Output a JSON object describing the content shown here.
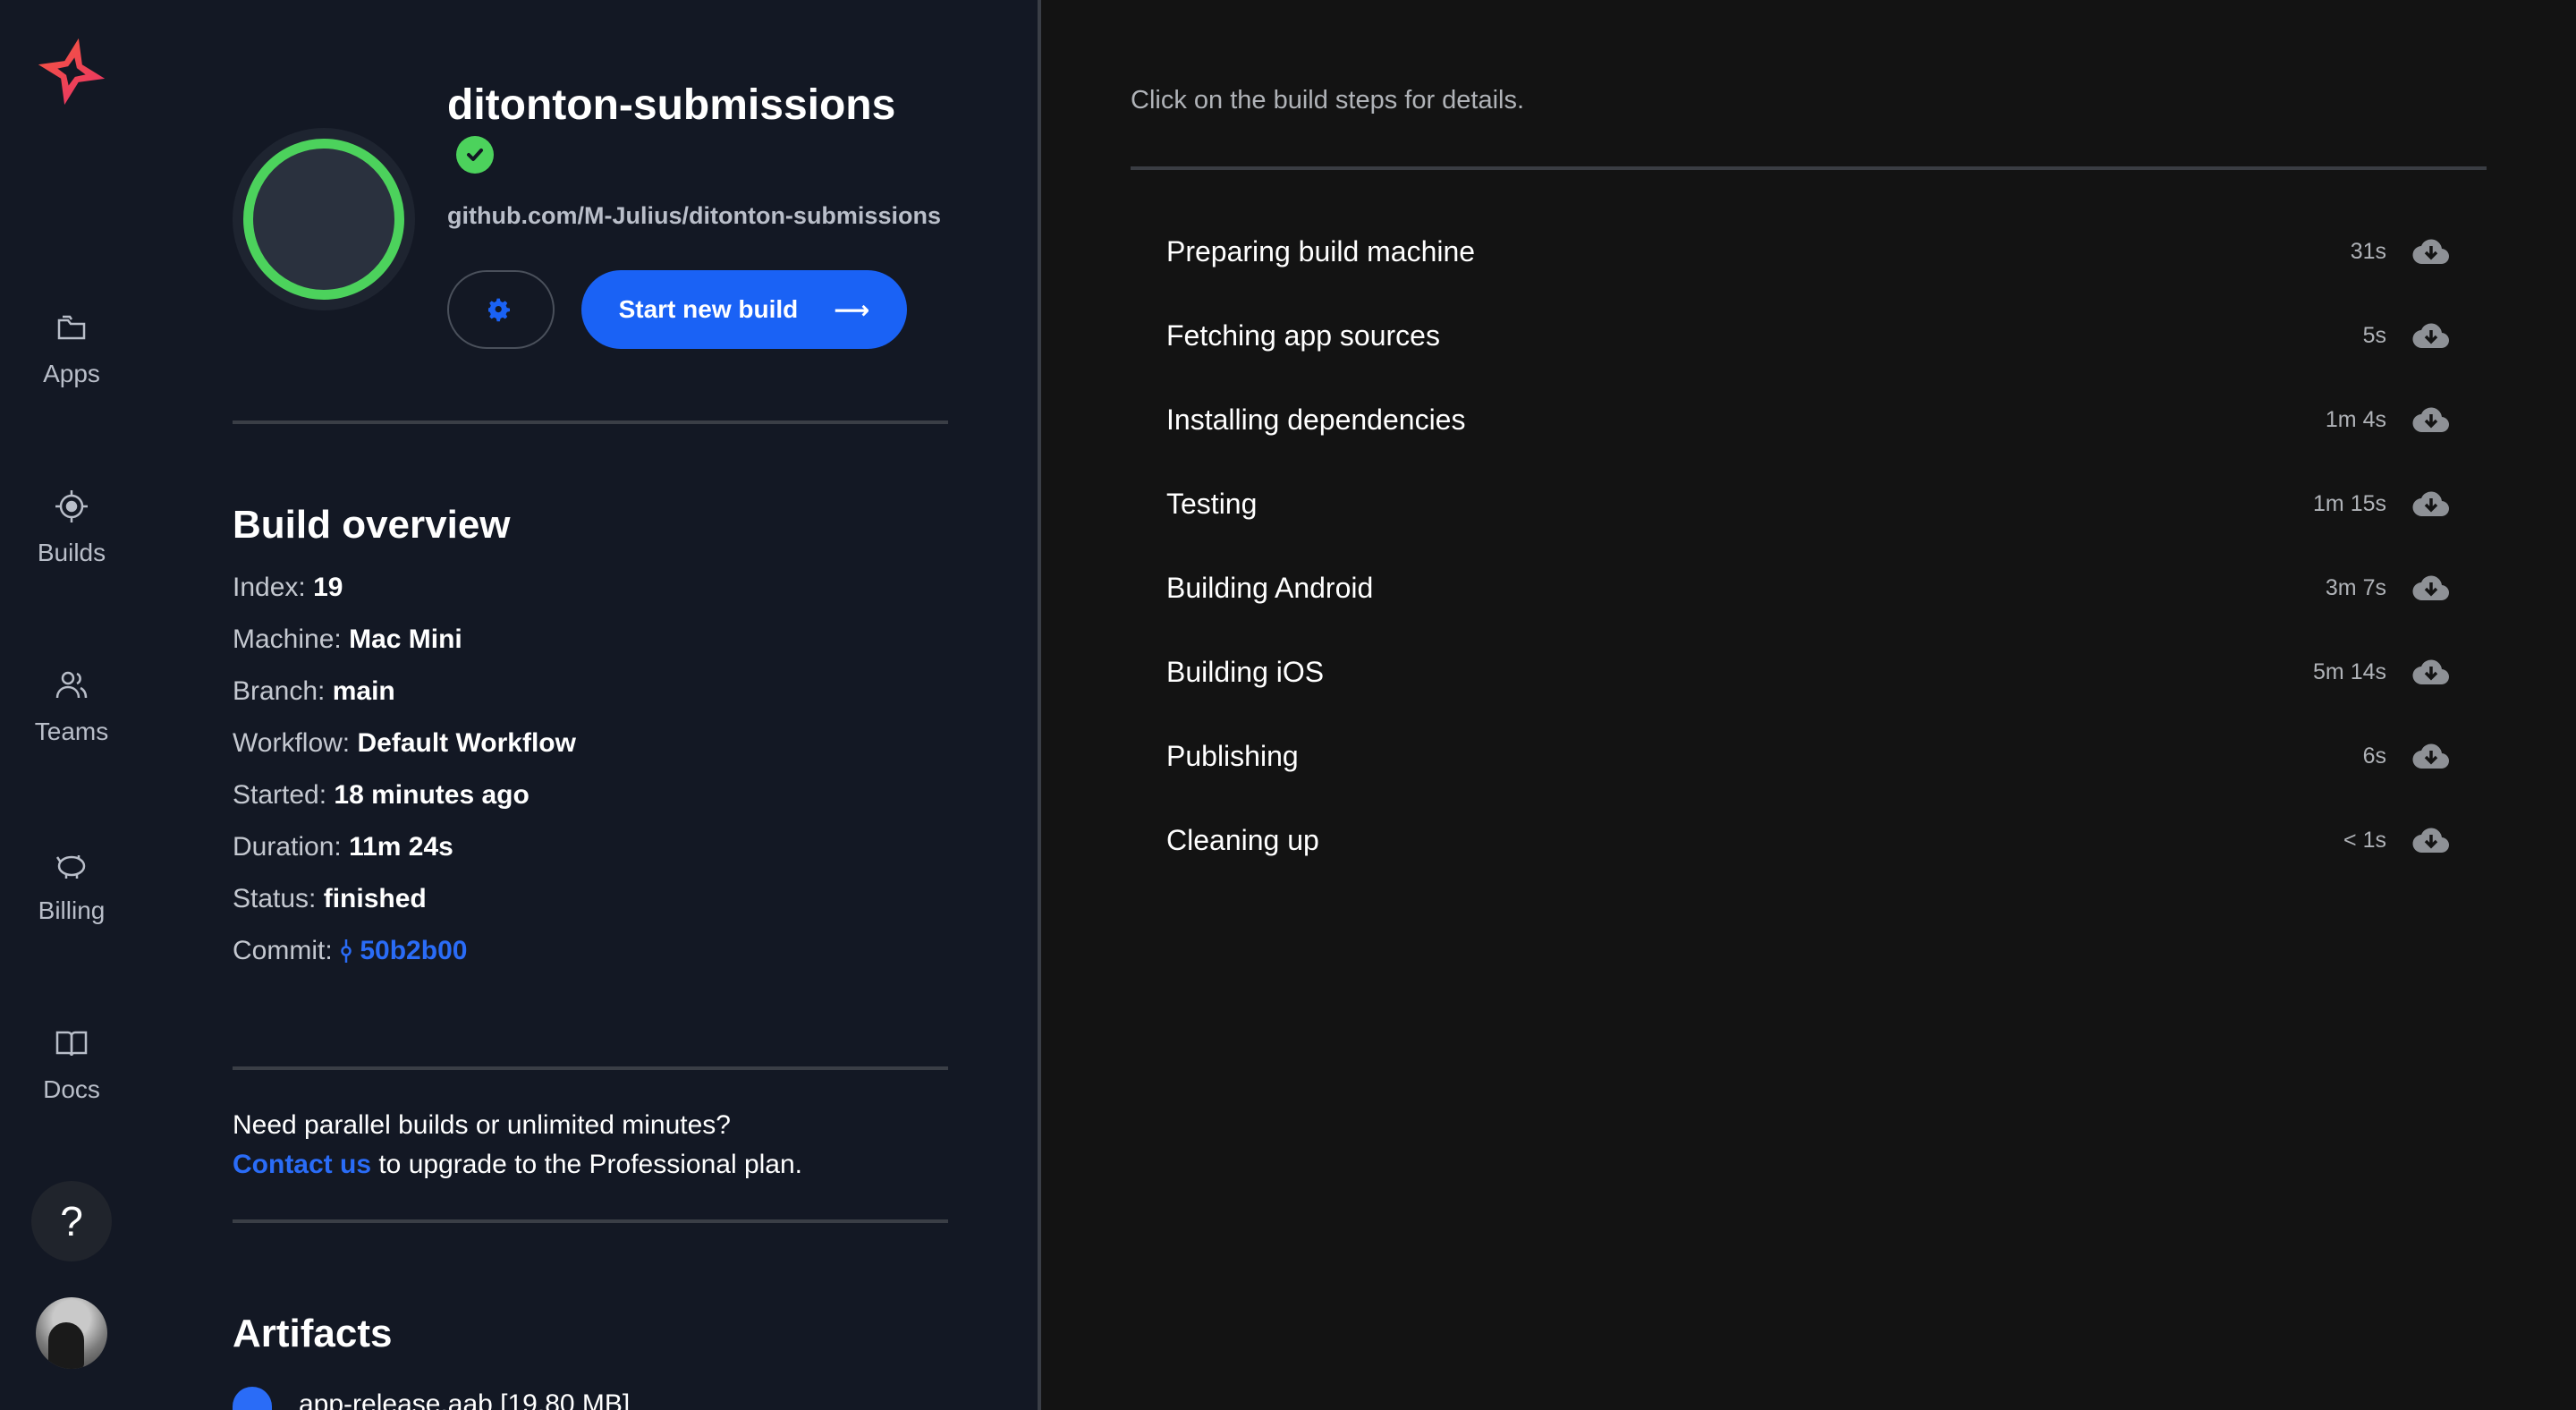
{
  "nav": {
    "items": [
      {
        "label": "Apps",
        "icon": "apps-icon"
      },
      {
        "label": "Builds",
        "icon": "builds-icon"
      },
      {
        "label": "Teams",
        "icon": "teams-icon"
      },
      {
        "label": "Billing",
        "icon": "billing-icon"
      },
      {
        "label": "Docs",
        "icon": "docs-icon"
      }
    ],
    "help": "?"
  },
  "app": {
    "name": "ditonton-submissions",
    "repo": "github.com/M-Julius/ditonton-submissions",
    "start_build_label": "Start new build",
    "arrow": "⟶"
  },
  "overview": {
    "title": "Build overview",
    "rows": [
      {
        "label": "Index:",
        "value": "19"
      },
      {
        "label": "Machine:",
        "value": "Mac Mini"
      },
      {
        "label": "Branch:",
        "value": "main"
      },
      {
        "label": "Workflow:",
        "value": "Default Workflow"
      },
      {
        "label": "Started:",
        "value": "18 minutes ago"
      },
      {
        "label": "Duration:",
        "value": "11m 24s"
      },
      {
        "label": "Status:",
        "value": "finished"
      }
    ],
    "commit_label": "Commit:",
    "commit_value": "50b2b00"
  },
  "promo": {
    "line1": "Need parallel builds or unlimited minutes?",
    "link": "Contact us",
    "line2": " to upgrade to the Professional plan."
  },
  "artifacts": {
    "title": "Artifacts",
    "items": [
      {
        "name": "app-release.aab [19.80 MB]"
      }
    ]
  },
  "steps_panel": {
    "hint": "Click on the build steps for details.",
    "steps": [
      {
        "name": "Preparing build machine",
        "duration": "31s"
      },
      {
        "name": "Fetching app sources",
        "duration": "5s"
      },
      {
        "name": "Installing dependencies",
        "duration": "1m 4s"
      },
      {
        "name": "Testing",
        "duration": "1m 15s"
      },
      {
        "name": "Building Android",
        "duration": "3m 7s"
      },
      {
        "name": "Building iOS",
        "duration": "5m 14s"
      },
      {
        "name": "Publishing",
        "duration": "6s"
      },
      {
        "name": "Cleaning up",
        "duration": "< 1s"
      }
    ]
  },
  "colors": {
    "accent": "#1a62f5",
    "success": "#4cd25c",
    "nav_bg": "#131824",
    "right_bg": "#131313"
  }
}
